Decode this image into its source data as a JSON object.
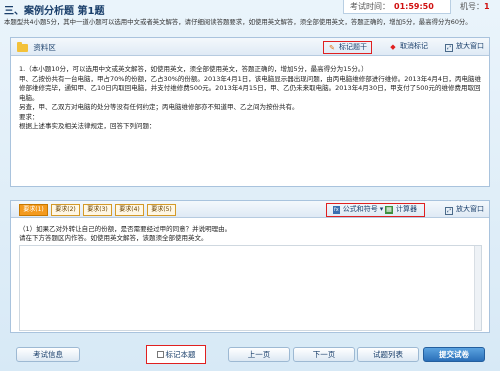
{
  "header": {
    "section_title": "三、案例分析题 第1题",
    "timer_label": "考试时间：",
    "timer_value": "01:59:50",
    "machine_label": "机号：",
    "machine_value": "1",
    "intro": "本题型共4小题5分，其中一道小题可以选用中文或者英文解答，请仔细阅读答题要求，如使用英文解答，须全部使用英文，答题正确的，增加5分，最高得分为60分。"
  },
  "resource": {
    "title": "资料区",
    "mark_stem": "标记题干",
    "cancel_mark": "取消标记",
    "expand": "放大窗口",
    "paragraphs": [
      "1.（本小题10分，可以选用中文或英文解答，如使用英文，须全部使用英文，答题正确的，增加5分，最高得分为15分。）",
      "甲、乙按份共有一台电脑，甲占70%的份额，乙占30%的份额。2013年4月1日，该电脑显示器出现问题，由丙电脑维修部进行维修。2013年4月4日，丙电脑维修部维修完毕，通知甲、乙10日内取回电脑，并支付维修费500元。2013年4月15日，甲、乙仍未来取电脑。2013年4月30日，甲支付了500元的维修费用取回电脑。",
      "另查，甲、乙双方对电脑的处分等没有任何约定；丙电脑维修部亦不知道甲、乙之间为按份共有。",
      "要求：",
      "根据上述事实及相关法律规定，回答下列问题："
    ]
  },
  "answer": {
    "tabs": [
      "要求(1)",
      "要求(2)",
      "要求(3)",
      "要求(4)",
      "要求(5)"
    ],
    "formula_label": "公式和符号",
    "calculator_label": "计算器",
    "expand": "放大窗口",
    "question": "（1）如果乙对外转让自己的份额，是否需要经过甲的同意？并说明理由。",
    "instruction": "请在下方答题区内作答。如使用英文解答，该题须全部使用英文。",
    "answer_value": ""
  },
  "footer": {
    "exam_info": "考试信息",
    "mark_question": "标记本题",
    "prev": "上一页",
    "next": "下一页",
    "question_list": "试题列表",
    "submit": "提交试卷"
  }
}
